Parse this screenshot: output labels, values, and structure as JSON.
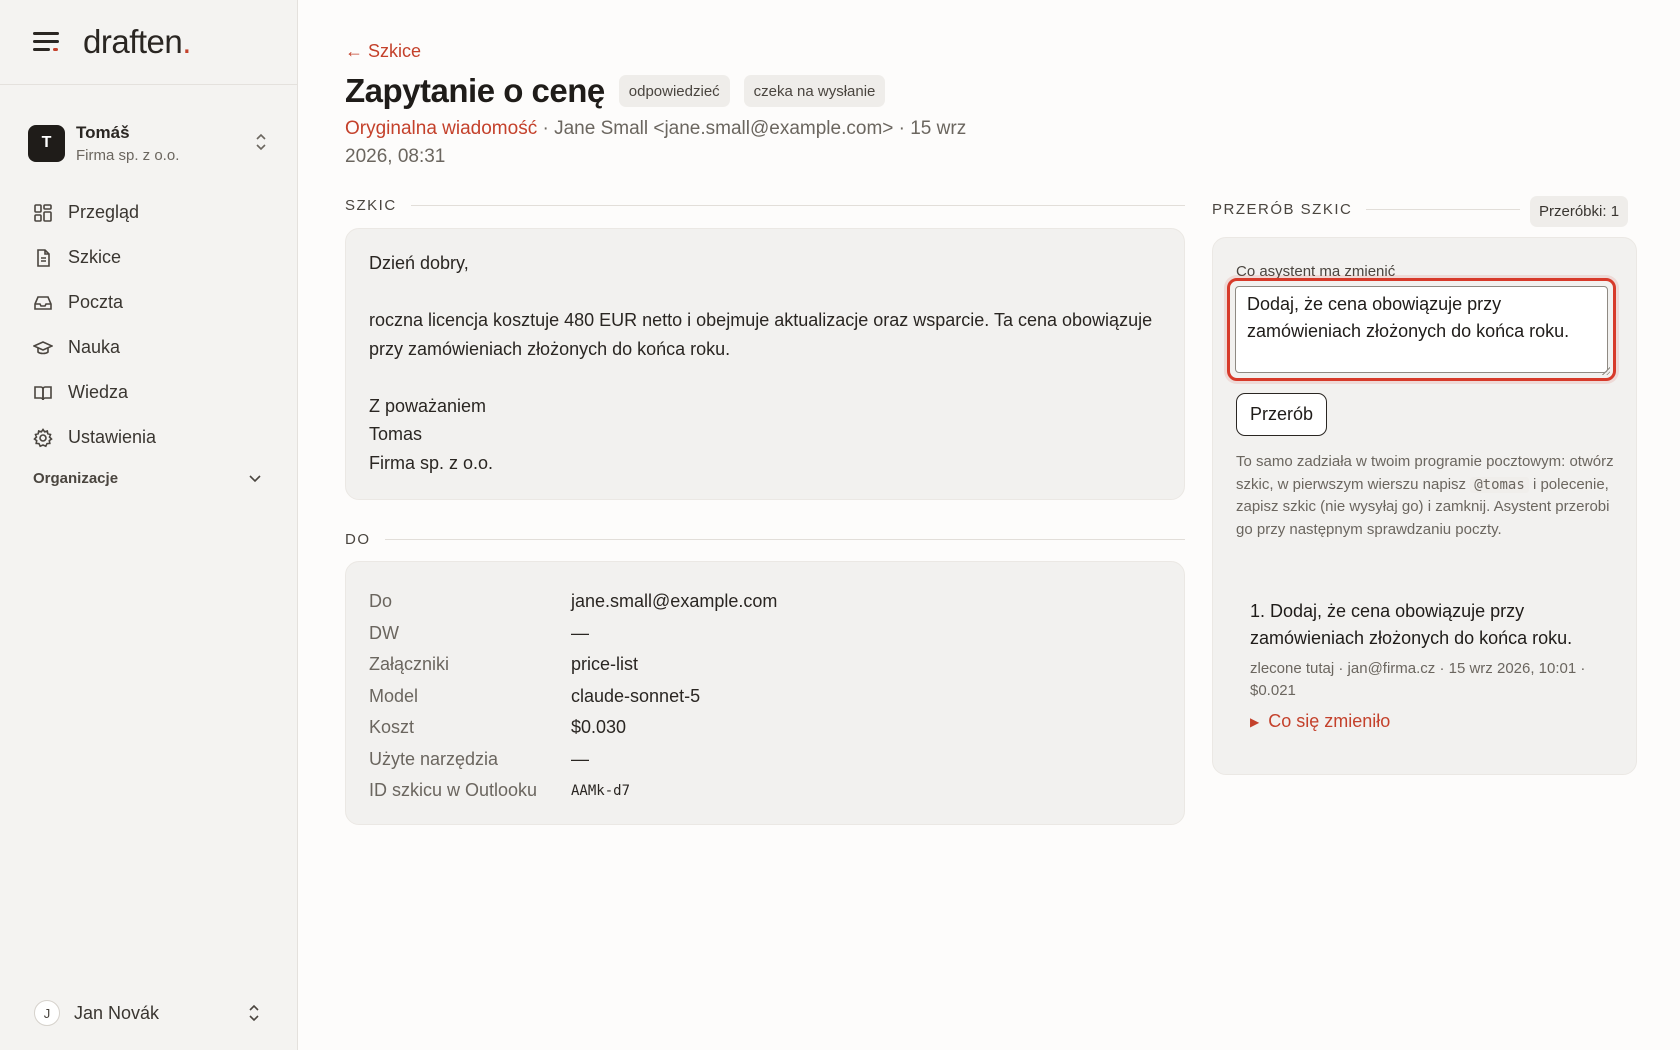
{
  "brand": {
    "name": "draften",
    "dot": "."
  },
  "account": {
    "initial": "T",
    "name": "Tomáš",
    "company": "Firma sp. z o.o."
  },
  "nav": [
    {
      "label": "Przegląd",
      "icon": "grid-icon"
    },
    {
      "label": "Szkice",
      "icon": "document-icon"
    },
    {
      "label": "Poczta",
      "icon": "inbox-icon"
    },
    {
      "label": "Nauka",
      "icon": "graduation-cap-icon"
    },
    {
      "label": "Wiedza",
      "icon": "book-icon"
    },
    {
      "label": "Ustawienia",
      "icon": "gear-icon"
    }
  ],
  "org_label": "Organizacje",
  "user": {
    "initial": "J",
    "name": "Jan Novák"
  },
  "header": {
    "back_label": "← Szkice",
    "title": "Zapytanie o cenę",
    "chip_reply": "odpowiedzieć",
    "chip_status": "czeka na wysłanie",
    "original_link": "Oryginalna wiadomość",
    "meta_rest": " · Jane Small <jane.small@example.com> · 15 wrz 2026, 08:31"
  },
  "draft": {
    "section_label": "SZKIC",
    "lines": [
      "Dzień dobry,",
      "",
      "roczna licencja kosztuje 480 EUR netto i obejmuje aktualizacje oraz wsparcie. Ta cena obowiązuje przy zamówieniach złożonych do końca roku.",
      "",
      "Z poważaniem",
      "Tomas",
      "Firma sp. z o.o."
    ]
  },
  "details": {
    "section_label": "DO",
    "rows": [
      {
        "key": "Do",
        "value": "jane.small@example.com"
      },
      {
        "key": "DW",
        "value": "—"
      },
      {
        "key": "Załączniki",
        "value": "price-list"
      },
      {
        "key": "Model",
        "value": "claude-sonnet-5"
      },
      {
        "key": "Koszt",
        "value": "$0.030"
      },
      {
        "key": "Użyte narzędzia",
        "value": "—"
      },
      {
        "key": "ID szkicu w Outlooku",
        "value": "AAMk-d7"
      }
    ]
  },
  "rework": {
    "section_label": "PRZERÓB SZKIC",
    "count_label": "Przeróbki: 1",
    "field_label": "Co asystent ma zmienić",
    "field_value": "Dodaj, że cena obowiązuje przy zamówieniach złożonych do końca roku.",
    "button_label": "Przerób",
    "help_before": "To samo zadziała w twoim programie pocztowym: otwórz szkic, w pierwszym wierszu napisz ",
    "help_code": "@tomas",
    "help_after": " i polecenie, zapisz szkic (nie wysyłaj go) i zamknij. Asystent przerobi go przy następnym sprawdzaniu poczty.",
    "history": [
      {
        "title": "1. Dodaj, że cena obowiązuje przy zamówieniach złożonych do końca roku.",
        "meta": "zlecone tutaj · jan@firma.cz · 15 wrz 2026, 10:01 · $0.021",
        "changes_label": "Co się zmieniło"
      }
    ]
  },
  "colors": {
    "accent": "#c4412b",
    "focus_ring": "#d73a2a",
    "card_bg": "#f2f1ef"
  }
}
